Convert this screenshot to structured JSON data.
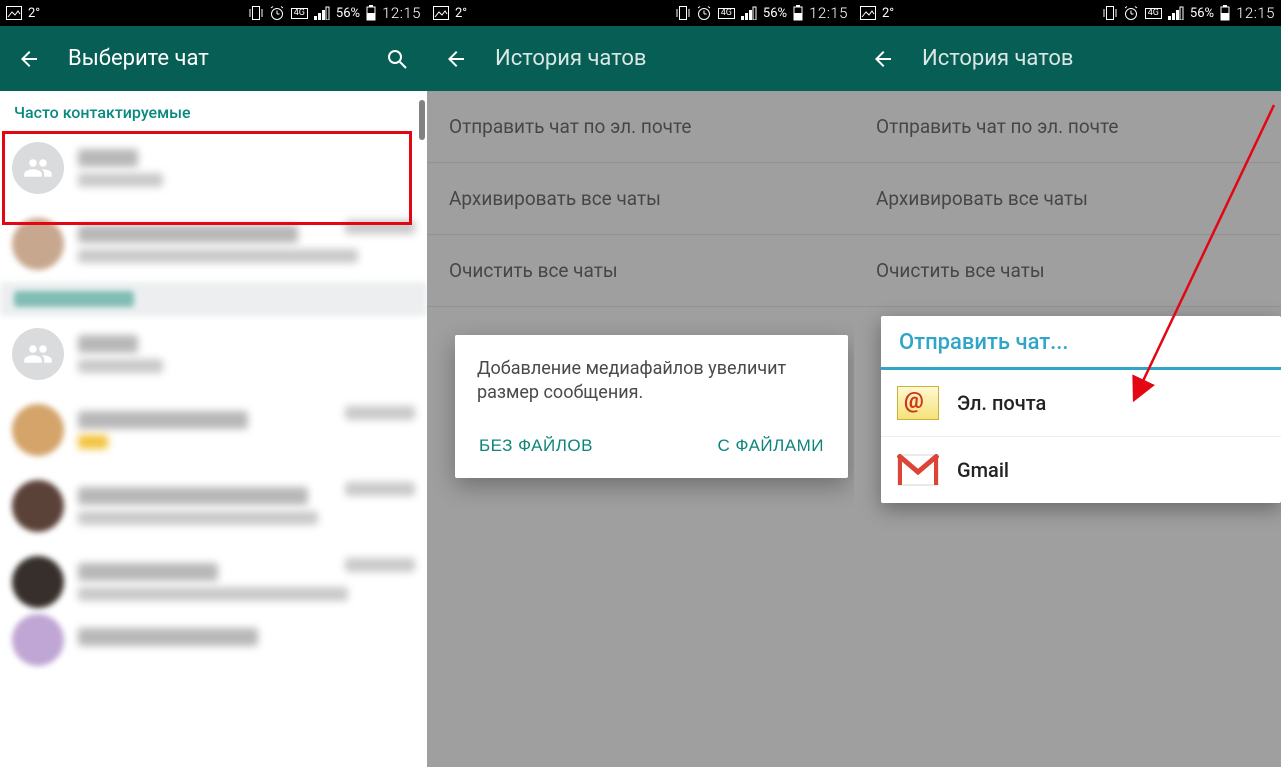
{
  "statusbar": {
    "temp": "2°",
    "battery_pct": "56%",
    "time": "12:15",
    "net_label": "4G"
  },
  "screen1": {
    "title": "Выберите чат",
    "section_header": "Часто контактируемые"
  },
  "screen2": {
    "title": "История чатов",
    "items": {
      "email": "Отправить чат по эл. почте",
      "archive": "Архивировать все чаты",
      "clear": "Очистить все чаты"
    },
    "dialog": {
      "message": "Добавление медиафайлов увеличит размер сообщения.",
      "btn_without": "БЕЗ ФАЙЛОВ",
      "btn_with": "С ФАЙЛАМИ"
    }
  },
  "screen3": {
    "title": "История чатов",
    "items": {
      "email": "Отправить чат по эл. почте",
      "archive": "Архивировать все чаты",
      "clear": "Очистить все чаты"
    },
    "sheet_title": "Отправить чат...",
    "option_email": "Эл. почта",
    "option_gmail": "Gmail"
  }
}
